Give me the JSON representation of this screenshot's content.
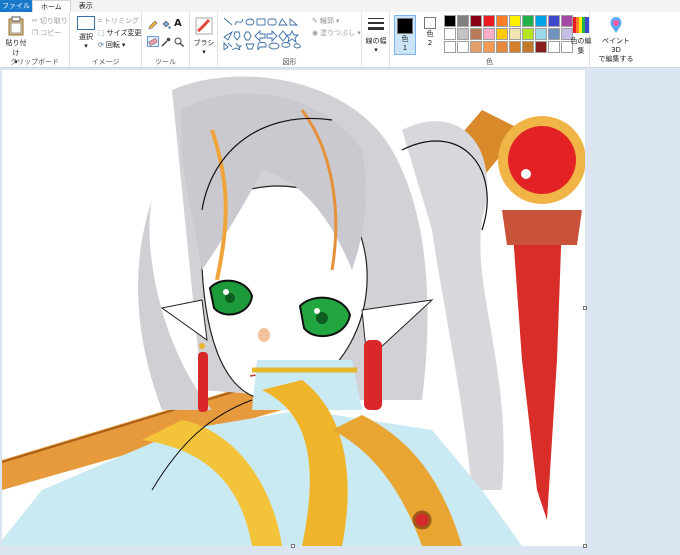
{
  "tabs": [
    {
      "label": "ファイル"
    },
    {
      "label": "ホーム"
    },
    {
      "label": "表示"
    }
  ],
  "clipboard": {
    "paste_label": "貼り付け",
    "cut_label": "切り取り",
    "copy_label": "コピー",
    "group_label": "クリップボード"
  },
  "image": {
    "select_label": "選択",
    "crop_label": "トリミング",
    "resize_label": "サイズ変更",
    "rotate_label": "回転",
    "group_label": "イメージ"
  },
  "tools": {
    "group_label": "ツール"
  },
  "brushes": {
    "label": "ブラシ"
  },
  "shapes": {
    "outline_label": "輪郭",
    "fill_label": "塗りつぶし",
    "group_label": "図形"
  },
  "size": {
    "label": "線の幅"
  },
  "colors": {
    "color1_label": "色",
    "color1_num": "1",
    "color2_label": "色",
    "color2_num": "2",
    "edit_label": "色の編集",
    "group_label": "色",
    "color1": "#000000",
    "color2": "#ffffff",
    "palette": [
      "#000000",
      "#7f7f7f",
      "#880015",
      "#ed1c24",
      "#ff7f27",
      "#fff200",
      "#22b14c",
      "#00a2e8",
      "#3f48cc",
      "#a349a4",
      "#ffffff",
      "#c3c3c3",
      "#b97a57",
      "#ffaec9",
      "#ffc90e",
      "#efe4b0",
      "#b5e61d",
      "#99d9ea",
      "#7092be",
      "#c8bfe7",
      "#ffffff",
      "#ffffff",
      "#e5a06a",
      "#f59a53",
      "#e58a3b",
      "#d7802c",
      "#c37a26",
      "#8a1d1d",
      "#ffffff",
      "#ffffff"
    ]
  },
  "paint3d": {
    "label_line1": "ペイント 3D",
    "label_line2": "で編集する"
  },
  "accent": {
    "file_tab": "#1979ca",
    "workspace": "#dbe4f1"
  }
}
